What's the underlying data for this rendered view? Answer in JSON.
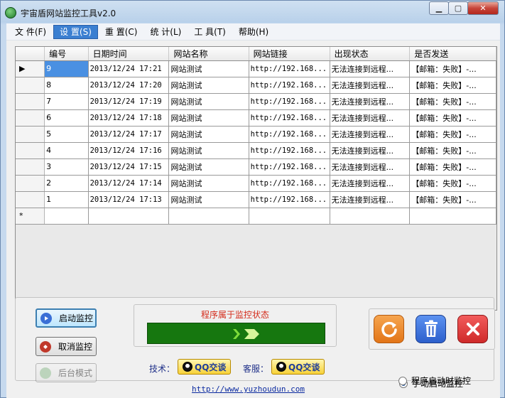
{
  "window": {
    "title": "宇宙盾网站监控工具v2.0"
  },
  "menu": [
    {
      "label": "文 件(F)"
    },
    {
      "label": "设 置(S)"
    },
    {
      "label": "重 置(C)"
    },
    {
      "label": "统 计(L)"
    },
    {
      "label": "工 具(T)"
    },
    {
      "label": "帮助(H)"
    }
  ],
  "table": {
    "columns": [
      "编号",
      "日期时间",
      "网站名称",
      "网站链接",
      "出现状态",
      "是否发送"
    ],
    "rows": [
      [
        "9",
        "2013/12/24 17:21",
        "网站测试",
        "http://192.168...",
        "无法连接到远程...",
        "【邮箱：失败】-..."
      ],
      [
        "8",
        "2013/12/24 17:20",
        "网站测试",
        "http://192.168...",
        "无法连接到远程...",
        "【邮箱：失败】-..."
      ],
      [
        "7",
        "2013/12/24 17:19",
        "网站测试",
        "http://192.168...",
        "无法连接到远程...",
        "【邮箱：失败】-..."
      ],
      [
        "6",
        "2013/12/24 17:18",
        "网站测试",
        "http://192.168...",
        "无法连接到远程...",
        "【邮箱：失败】-..."
      ],
      [
        "5",
        "2013/12/24 17:17",
        "网站测试",
        "http://192.168...",
        "无法连接到远程...",
        "【邮箱：失败】-..."
      ],
      [
        "4",
        "2013/12/24 17:16",
        "网站测试",
        "http://192.168...",
        "无法连接到远程...",
        "【邮箱：失败】-..."
      ],
      [
        "3",
        "2013/12/24 17:15",
        "网站测试",
        "http://192.168...",
        "无法连接到远程...",
        "【邮箱：失败】-..."
      ],
      [
        "2",
        "2013/12/24 17:14",
        "网站测试",
        "http://192.168...",
        "无法连接到远程...",
        "【邮箱：失败】-..."
      ],
      [
        "1",
        "2013/12/24 17:13",
        "网站测试",
        "http://192.168...",
        "无法连接到远程...",
        "【邮箱：失败】-..."
      ]
    ],
    "current_marker": "▶",
    "new_row_marker": "*"
  },
  "buttons": {
    "start": "启动监控",
    "cancel": "取消监控",
    "third": "后台模式"
  },
  "status": {
    "label": "程序属于监控状态"
  },
  "contact": {
    "tech_label": "技术：",
    "service_label": "客服：",
    "qq_label": "QQ交谈",
    "website": "http://www.yuzhoudun.com"
  },
  "options": {
    "manual": "手动启动监控",
    "auto": "程序启动时监控",
    "selected": "manual"
  },
  "icons": [
    "app-icon",
    "refresh-icon",
    "trash-icon",
    "close-x-icon",
    "play-icon",
    "stop-icon",
    "qq-icon",
    "chevron-arrows-icon"
  ],
  "colors": {
    "refresh": "#f08a2a",
    "trash": "#3a6fd6",
    "close": "#e03838",
    "progress": "#16770f",
    "status_text": "#d42b1a"
  }
}
